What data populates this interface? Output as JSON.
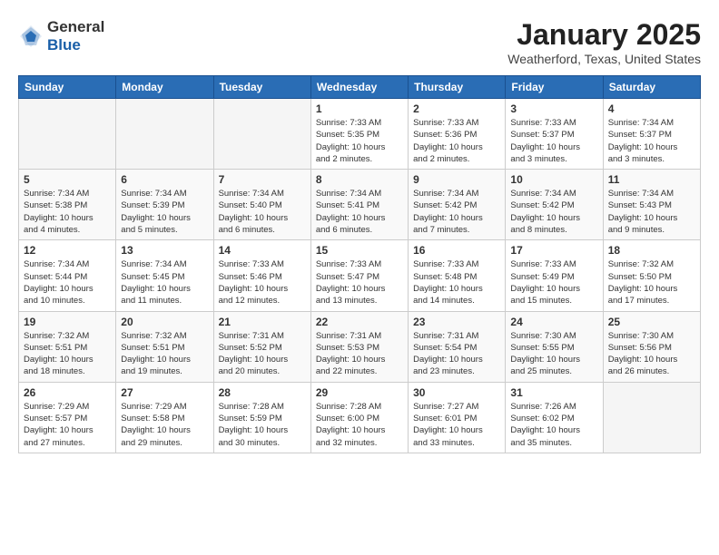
{
  "header": {
    "logo_general": "General",
    "logo_blue": "Blue",
    "title": "January 2025",
    "location": "Weatherford, Texas, United States"
  },
  "calendar": {
    "weekdays": [
      "Sunday",
      "Monday",
      "Tuesday",
      "Wednesday",
      "Thursday",
      "Friday",
      "Saturday"
    ],
    "weeks": [
      [
        {
          "day": "",
          "info": ""
        },
        {
          "day": "",
          "info": ""
        },
        {
          "day": "",
          "info": ""
        },
        {
          "day": "1",
          "info": "Sunrise: 7:33 AM\nSunset: 5:35 PM\nDaylight: 10 hours\nand 2 minutes."
        },
        {
          "day": "2",
          "info": "Sunrise: 7:33 AM\nSunset: 5:36 PM\nDaylight: 10 hours\nand 2 minutes."
        },
        {
          "day": "3",
          "info": "Sunrise: 7:33 AM\nSunset: 5:37 PM\nDaylight: 10 hours\nand 3 minutes."
        },
        {
          "day": "4",
          "info": "Sunrise: 7:34 AM\nSunset: 5:37 PM\nDaylight: 10 hours\nand 3 minutes."
        }
      ],
      [
        {
          "day": "5",
          "info": "Sunrise: 7:34 AM\nSunset: 5:38 PM\nDaylight: 10 hours\nand 4 minutes."
        },
        {
          "day": "6",
          "info": "Sunrise: 7:34 AM\nSunset: 5:39 PM\nDaylight: 10 hours\nand 5 minutes."
        },
        {
          "day": "7",
          "info": "Sunrise: 7:34 AM\nSunset: 5:40 PM\nDaylight: 10 hours\nand 6 minutes."
        },
        {
          "day": "8",
          "info": "Sunrise: 7:34 AM\nSunset: 5:41 PM\nDaylight: 10 hours\nand 6 minutes."
        },
        {
          "day": "9",
          "info": "Sunrise: 7:34 AM\nSunset: 5:42 PM\nDaylight: 10 hours\nand 7 minutes."
        },
        {
          "day": "10",
          "info": "Sunrise: 7:34 AM\nSunset: 5:42 PM\nDaylight: 10 hours\nand 8 minutes."
        },
        {
          "day": "11",
          "info": "Sunrise: 7:34 AM\nSunset: 5:43 PM\nDaylight: 10 hours\nand 9 minutes."
        }
      ],
      [
        {
          "day": "12",
          "info": "Sunrise: 7:34 AM\nSunset: 5:44 PM\nDaylight: 10 hours\nand 10 minutes."
        },
        {
          "day": "13",
          "info": "Sunrise: 7:34 AM\nSunset: 5:45 PM\nDaylight: 10 hours\nand 11 minutes."
        },
        {
          "day": "14",
          "info": "Sunrise: 7:33 AM\nSunset: 5:46 PM\nDaylight: 10 hours\nand 12 minutes."
        },
        {
          "day": "15",
          "info": "Sunrise: 7:33 AM\nSunset: 5:47 PM\nDaylight: 10 hours\nand 13 minutes."
        },
        {
          "day": "16",
          "info": "Sunrise: 7:33 AM\nSunset: 5:48 PM\nDaylight: 10 hours\nand 14 minutes."
        },
        {
          "day": "17",
          "info": "Sunrise: 7:33 AM\nSunset: 5:49 PM\nDaylight: 10 hours\nand 15 minutes."
        },
        {
          "day": "18",
          "info": "Sunrise: 7:32 AM\nSunset: 5:50 PM\nDaylight: 10 hours\nand 17 minutes."
        }
      ],
      [
        {
          "day": "19",
          "info": "Sunrise: 7:32 AM\nSunset: 5:51 PM\nDaylight: 10 hours\nand 18 minutes."
        },
        {
          "day": "20",
          "info": "Sunrise: 7:32 AM\nSunset: 5:51 PM\nDaylight: 10 hours\nand 19 minutes."
        },
        {
          "day": "21",
          "info": "Sunrise: 7:31 AM\nSunset: 5:52 PM\nDaylight: 10 hours\nand 20 minutes."
        },
        {
          "day": "22",
          "info": "Sunrise: 7:31 AM\nSunset: 5:53 PM\nDaylight: 10 hours\nand 22 minutes."
        },
        {
          "day": "23",
          "info": "Sunrise: 7:31 AM\nSunset: 5:54 PM\nDaylight: 10 hours\nand 23 minutes."
        },
        {
          "day": "24",
          "info": "Sunrise: 7:30 AM\nSunset: 5:55 PM\nDaylight: 10 hours\nand 25 minutes."
        },
        {
          "day": "25",
          "info": "Sunrise: 7:30 AM\nSunset: 5:56 PM\nDaylight: 10 hours\nand 26 minutes."
        }
      ],
      [
        {
          "day": "26",
          "info": "Sunrise: 7:29 AM\nSunset: 5:57 PM\nDaylight: 10 hours\nand 27 minutes."
        },
        {
          "day": "27",
          "info": "Sunrise: 7:29 AM\nSunset: 5:58 PM\nDaylight: 10 hours\nand 29 minutes."
        },
        {
          "day": "28",
          "info": "Sunrise: 7:28 AM\nSunset: 5:59 PM\nDaylight: 10 hours\nand 30 minutes."
        },
        {
          "day": "29",
          "info": "Sunrise: 7:28 AM\nSunset: 6:00 PM\nDaylight: 10 hours\nand 32 minutes."
        },
        {
          "day": "30",
          "info": "Sunrise: 7:27 AM\nSunset: 6:01 PM\nDaylight: 10 hours\nand 33 minutes."
        },
        {
          "day": "31",
          "info": "Sunrise: 7:26 AM\nSunset: 6:02 PM\nDaylight: 10 hours\nand 35 minutes."
        },
        {
          "day": "",
          "info": ""
        }
      ]
    ]
  }
}
